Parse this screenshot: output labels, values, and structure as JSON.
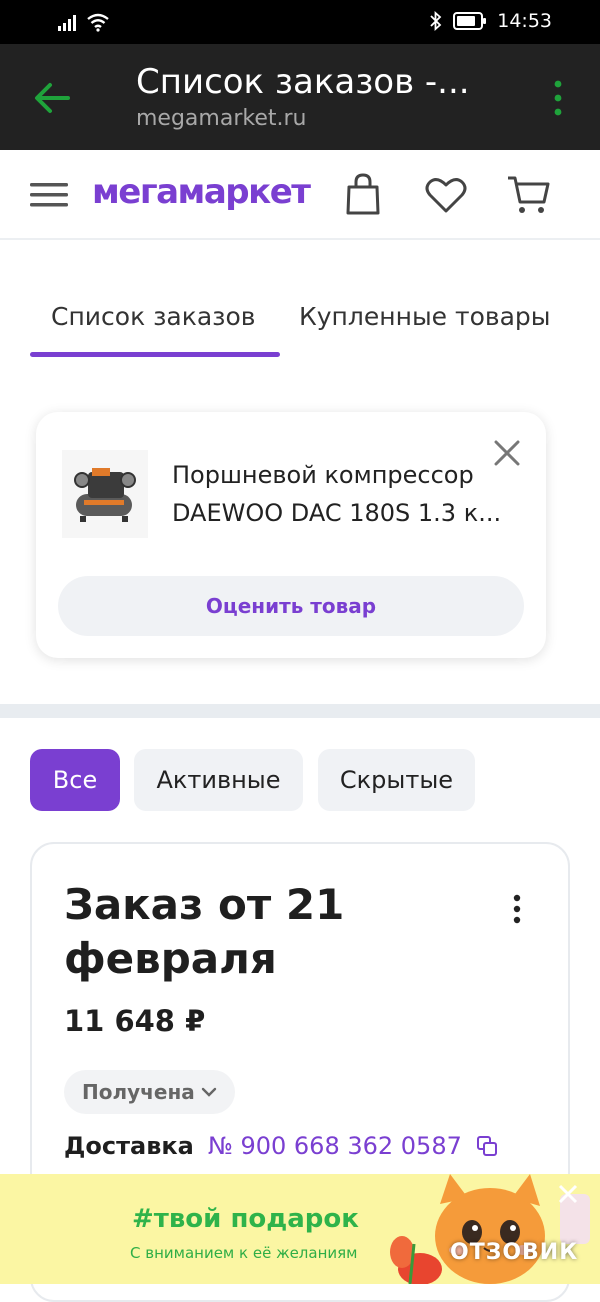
{
  "statusbar": {
    "time": "14:53"
  },
  "browser": {
    "title": "Список заказов -...",
    "url": "megamarket.ru"
  },
  "site": {
    "logo": "мегамаркет"
  },
  "tabs": [
    {
      "label": "Список заказов",
      "active": true
    },
    {
      "label": "Купленные товары",
      "active": false
    }
  ],
  "review_card": {
    "product_title": "Поршневой компрессор DAEWOO DAC 180S 1.3 к...",
    "rate_button": "Оценить товар"
  },
  "filters": [
    {
      "label": "Все",
      "active": true
    },
    {
      "label": "Активные",
      "active": false
    },
    {
      "label": "Скрытые",
      "active": false
    }
  ],
  "order": {
    "title": "Заказ от 21 февраля",
    "total": "11 648 ₽",
    "status": "Получена",
    "delivery_label": "Доставка",
    "delivery_number": "№ 900 668 362 0587"
  },
  "promo": {
    "title": "#твой подарок",
    "subtitle": "С вниманием к её желаниям"
  },
  "watermark": "ОТЗОВИК",
  "colors": {
    "accent": "#7a3fd1",
    "browser_bar": "#222222",
    "promo_bg": "#fbf6a3",
    "promo_text": "#2fb34a",
    "back_arrow": "#1fa33b"
  }
}
